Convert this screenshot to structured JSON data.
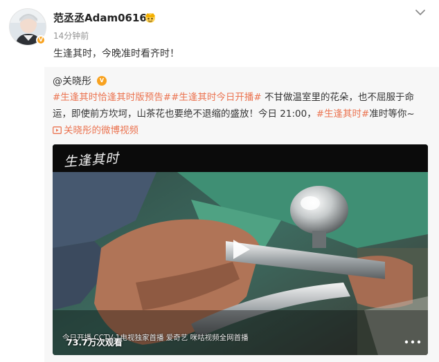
{
  "post": {
    "username": "范丞丞Adam0616",
    "timestamp": "14分钟前",
    "text": "生逢其时，今晚准时看齐时！"
  },
  "repost": {
    "author": "@关晓彤",
    "tags": {
      "tag1": "#生逢其时恰逢其时版预告#",
      "tag2": "#生逢其时今日开播#",
      "tag3": "#生逢其时#"
    },
    "text_part1": " 不甘做温室里的花朵，也不屈服于命运，即使前方坎坷，山茶花也要绝不退缩的盛放！今日 21:00，",
    "text_part2": "准时等你~",
    "video_link": "关晓彤的微博视频",
    "video": {
      "logo": "生逢其时",
      "subtitle": "今日开播 CCTV-1电视独家首播 爱奇艺 咪咕视频全网首播",
      "views": "73.7万次观看"
    }
  },
  "colors": {
    "accent_orange": "#eb7350",
    "verify_badge": "#f8a21f",
    "repost_bg": "#f7f7f7"
  },
  "icons": [
    "chevron-down-icon",
    "vip-crown-icon",
    "verified-badge-icon",
    "video-camera-icon",
    "play-icon",
    "more-icon"
  ]
}
